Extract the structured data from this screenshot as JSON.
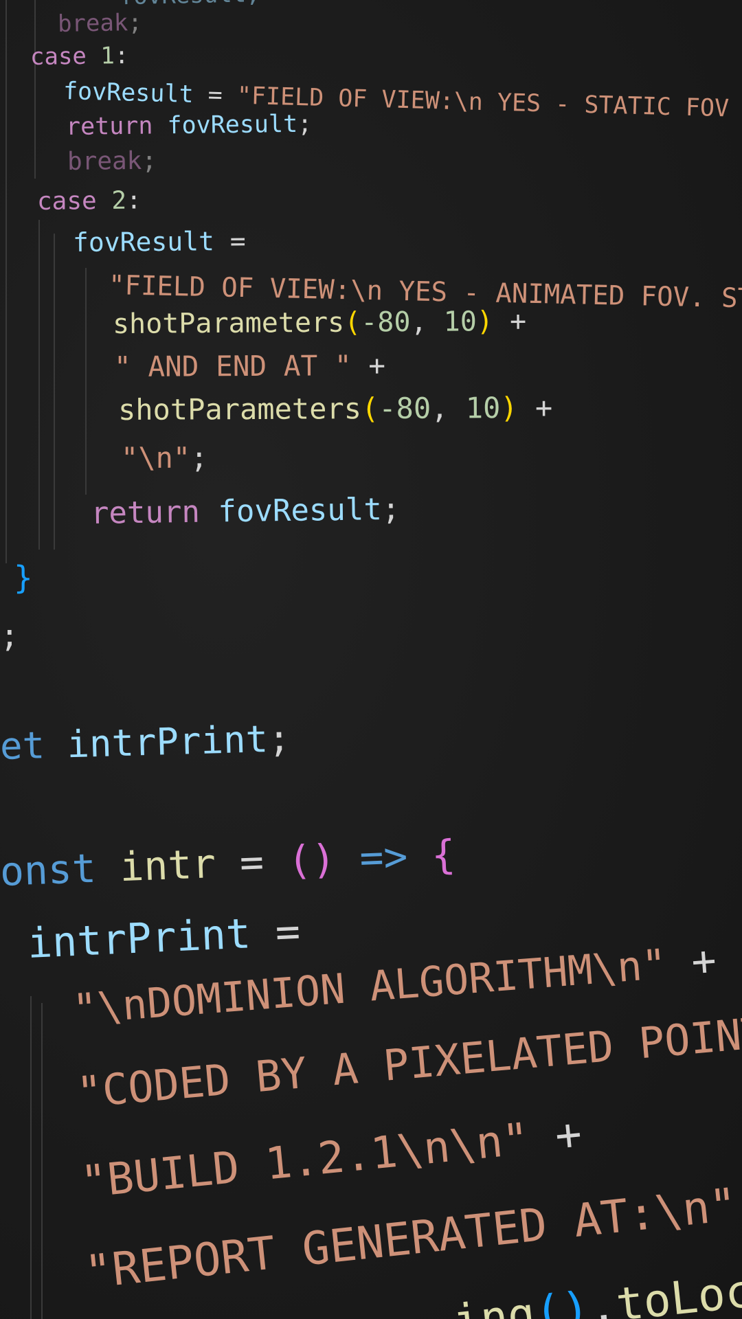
{
  "editor": {
    "lines": [
      {
        "id": "l0",
        "tokens": [
          {
            "t": "    fovResult;",
            "c": "var"
          }
        ]
      },
      {
        "id": "l1",
        "tokens": [
          {
            "t": "break",
            "c": "kw-pink"
          },
          {
            "t": ";",
            "c": "op"
          }
        ]
      },
      {
        "id": "l2",
        "tokens": [
          {
            "t": "case ",
            "c": "kw-pink"
          },
          {
            "t": "1",
            "c": "num"
          },
          {
            "t": ":",
            "c": "op"
          }
        ]
      },
      {
        "id": "l3",
        "tokens": [
          {
            "t": "fovResult",
            "c": "var"
          },
          {
            "t": " = ",
            "c": "op"
          },
          {
            "t": "\"FIELD OF VIEW:\\n YES - STATIC FOV OF",
            "c": "str"
          }
        ]
      },
      {
        "id": "l4",
        "tokens": [
          {
            "t": "return ",
            "c": "kw-pink"
          },
          {
            "t": "fovResult",
            "c": "var"
          },
          {
            "t": ";",
            "c": "op"
          }
        ]
      },
      {
        "id": "l5",
        "tokens": [
          {
            "t": "break",
            "c": "kw-pink"
          },
          {
            "t": ";",
            "c": "op"
          }
        ]
      },
      {
        "id": "l6",
        "tokens": [
          {
            "t": "case ",
            "c": "kw-pink"
          },
          {
            "t": "2",
            "c": "num"
          },
          {
            "t": ":",
            "c": "op"
          }
        ]
      },
      {
        "id": "l7",
        "tokens": [
          {
            "t": "fovResult",
            "c": "var"
          },
          {
            "t": " =",
            "c": "op"
          }
        ]
      },
      {
        "id": "l8",
        "tokens": [
          {
            "t": "\"FIELD OF VIEW:\\n YES - ANIMATED FOV. STA",
            "c": "str"
          }
        ]
      },
      {
        "id": "l9",
        "tokens": [
          {
            "t": "shotParameters",
            "c": "fn"
          },
          {
            "t": "(",
            "c": "paren-yellow"
          },
          {
            "t": "-80",
            "c": "num"
          },
          {
            "t": ", ",
            "c": "op"
          },
          {
            "t": "10",
            "c": "num"
          },
          {
            "t": ")",
            "c": "paren-yellow"
          },
          {
            "t": " +",
            "c": "op"
          }
        ]
      },
      {
        "id": "l10",
        "tokens": [
          {
            "t": "\" AND END AT \"",
            "c": "str"
          },
          {
            "t": " +",
            "c": "op"
          }
        ]
      },
      {
        "id": "l11",
        "tokens": [
          {
            "t": "shotParameters",
            "c": "fn"
          },
          {
            "t": "(",
            "c": "paren-yellow"
          },
          {
            "t": "-80",
            "c": "num"
          },
          {
            "t": ", ",
            "c": "op"
          },
          {
            "t": "10",
            "c": "num"
          },
          {
            "t": ")",
            "c": "paren-yellow"
          },
          {
            "t": " +",
            "c": "op"
          }
        ]
      },
      {
        "id": "l12",
        "tokens": [
          {
            "t": "\"\\n\"",
            "c": "str"
          },
          {
            "t": ";",
            "c": "op"
          }
        ]
      },
      {
        "id": "l13",
        "tokens": [
          {
            "t": "return ",
            "c": "kw-pink"
          },
          {
            "t": "fovResult",
            "c": "var"
          },
          {
            "t": ";",
            "c": "op"
          }
        ]
      },
      {
        "id": "l14",
        "tokens": [
          {
            "t": "}",
            "c": "brace-blue"
          }
        ]
      },
      {
        "id": "l15",
        "tokens": [
          {
            "t": ";",
            "c": "op"
          }
        ]
      },
      {
        "id": "l16",
        "tokens": [
          {
            "t": "et ",
            "c": "kw-blue"
          },
          {
            "t": "intrPrint",
            "c": "var"
          },
          {
            "t": ";",
            "c": "op"
          }
        ]
      },
      {
        "id": "l17",
        "tokens": [
          {
            "t": "onst ",
            "c": "kw-blue"
          },
          {
            "t": "intr",
            "c": "fn"
          },
          {
            "t": " = ",
            "c": "op"
          },
          {
            "t": "()",
            "c": "paren-pink"
          },
          {
            "t": " => ",
            "c": "kw-blue"
          },
          {
            "t": "{",
            "c": "paren-pink"
          }
        ]
      },
      {
        "id": "l18",
        "tokens": [
          {
            "t": "intrPrint",
            "c": "var"
          },
          {
            "t": " =",
            "c": "op"
          }
        ]
      },
      {
        "id": "l19",
        "tokens": [
          {
            "t": "\"\\nDOMINION ALGORITHM\\n\"",
            "c": "str"
          },
          {
            "t": " +",
            "c": "op"
          }
        ]
      },
      {
        "id": "l20",
        "tokens": [
          {
            "t": "\"CODED BY A PIXELATED POINT OF",
            "c": "str"
          }
        ]
      },
      {
        "id": "l21",
        "tokens": [
          {
            "t": "\"BUILD 1.2.1\\n\\n\"",
            "c": "str"
          },
          {
            "t": " +",
            "c": "op"
          }
        ]
      },
      {
        "id": "l22",
        "tokens": [
          {
            "t": "\"REPORT GENERATED AT:\\n\"",
            "c": "str"
          },
          {
            "t": " +",
            "c": "op"
          }
        ]
      },
      {
        "id": "l23",
        "tokens": [
          {
            "t": "ing",
            "c": "fn"
          },
          {
            "t": "()",
            "c": "brace-blue"
          },
          {
            "t": ".",
            "c": "op"
          },
          {
            "t": "toLocale",
            "c": "fn"
          }
        ]
      }
    ]
  }
}
